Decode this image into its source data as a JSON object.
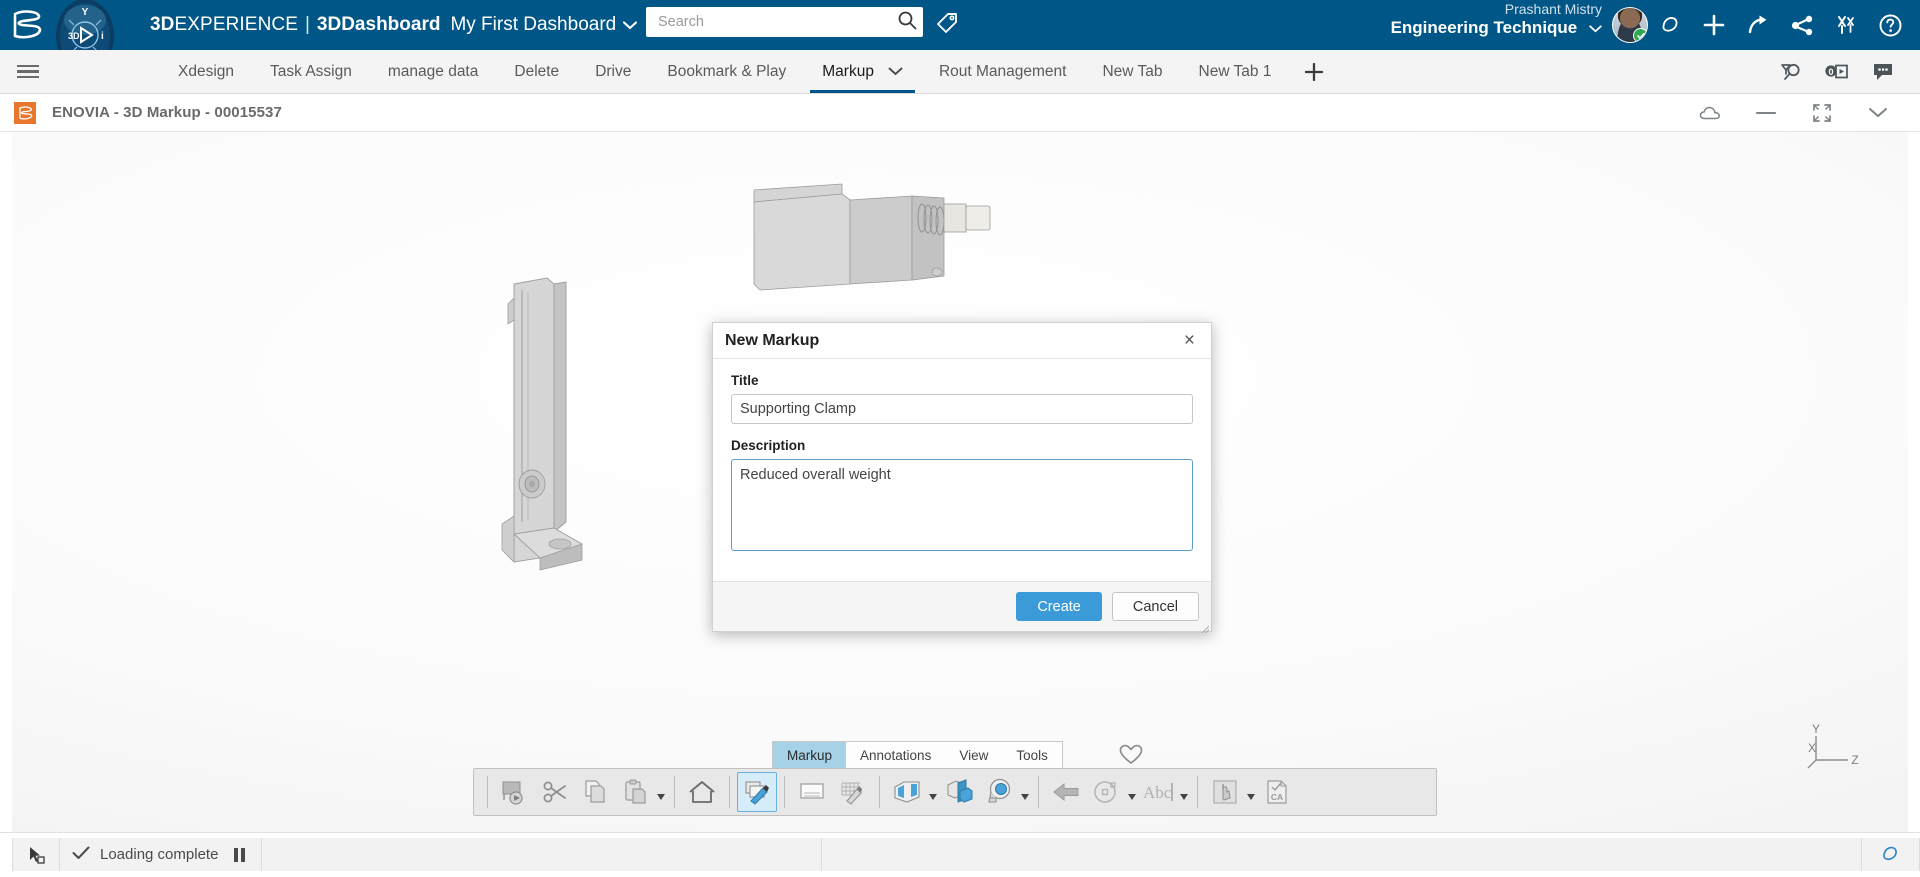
{
  "header": {
    "brand_prefix": "3D",
    "brand_suffix": "EXPERIENCE",
    "separator": "|",
    "product": "3DDashboard",
    "dashboard_name": "My First Dashboard",
    "caret": "⌄",
    "search_placeholder": "Search",
    "search_value": "",
    "user_name": "Prashant Mistry",
    "user_role": "Engineering Technique",
    "icons": [
      "ds-logo-icon",
      "compass-icon",
      "search-icon",
      "tag-icon",
      "avatar",
      "notification-bell-icon",
      "add-plus-icon",
      "share-arrow-icon",
      "social-share-icon",
      "collaboration-icon",
      "help-icon"
    ]
  },
  "tabbar": {
    "menu_icon": "hamburger-menu-icon",
    "tabs": [
      {
        "label": "Xdesign",
        "active": false,
        "has_caret": false
      },
      {
        "label": "Task Assign",
        "active": false,
        "has_caret": false
      },
      {
        "label": "manage data",
        "active": false,
        "has_caret": false
      },
      {
        "label": "Delete",
        "active": false,
        "has_caret": false
      },
      {
        "label": "Drive",
        "active": false,
        "has_caret": false
      },
      {
        "label": "Bookmark & Play",
        "active": false,
        "has_caret": false
      },
      {
        "label": "Markup",
        "active": true,
        "has_caret": true
      },
      {
        "label": "Rout Management",
        "active": false,
        "has_caret": false
      },
      {
        "label": "New Tab",
        "active": false,
        "has_caret": false
      },
      {
        "label": "New Tab 1",
        "active": false,
        "has_caret": false
      }
    ],
    "add_tab_label": "+",
    "right_icons": [
      "search-inspect-icon",
      "media-play-count-icon",
      "comments-icon"
    ]
  },
  "app_window": {
    "logo": "enovia-3ds-icon",
    "title": "ENOVIA - 3D Markup - 00015537",
    "controls": [
      "cloud-icon",
      "minimize-icon",
      "fullscreen-icon",
      "chevron-down-icon"
    ]
  },
  "viewport": {
    "axis_labels": {
      "x": "X",
      "y": "Y",
      "z": "Z"
    },
    "background_note": "3D model of a supporting clamp bracket assembly"
  },
  "command_tabs": {
    "items": [
      {
        "label": "Markup",
        "active": true
      },
      {
        "label": "Annotations",
        "active": false
      },
      {
        "label": "View",
        "active": false
      },
      {
        "label": "Tools",
        "active": false
      }
    ],
    "favorite_icon": "heart-icon"
  },
  "toolbar": {
    "tools": [
      {
        "name": "screen-capture-icon",
        "selected": false,
        "caret": false
      },
      {
        "name": "cut-scissors-icon",
        "selected": false,
        "caret": false
      },
      {
        "name": "copy-icon",
        "selected": false,
        "caret": false
      },
      {
        "name": "paste-icon",
        "selected": false,
        "caret": true
      },
      {
        "name": "home-icon",
        "selected": false,
        "caret": false
      },
      {
        "name": "new-markup-icon",
        "selected": true,
        "caret": false
      },
      {
        "name": "slide-icon",
        "selected": false,
        "caret": false
      },
      {
        "name": "grid-edit-icon",
        "selected": false,
        "caret": false
      },
      {
        "name": "view-capture-icon",
        "selected": false,
        "caret": true
      },
      {
        "name": "section-view-icon",
        "selected": false,
        "caret": false
      },
      {
        "name": "measure-tape-icon",
        "selected": false,
        "caret": true
      },
      {
        "name": "arrow-annotation-icon",
        "selected": false,
        "caret": false
      },
      {
        "name": "circle-annotation-icon",
        "selected": false,
        "caret": true
      },
      {
        "name": "text-abc-icon",
        "selected": false,
        "caret": true
      },
      {
        "name": "pointer-hand-icon",
        "selected": false,
        "caret": true
      },
      {
        "name": "export-ca-icon",
        "selected": false,
        "caret": false
      }
    ]
  },
  "dialog": {
    "title": "New Markup",
    "close_label": "×",
    "title_field": {
      "label": "Title",
      "value": "Supporting Clamp",
      "placeholder": ""
    },
    "description_field": {
      "label": "Description",
      "value": "Reduced overall weight",
      "placeholder": ""
    },
    "create_label": "Create",
    "cancel_label": "Cancel"
  },
  "statusbar": {
    "pick_icon": "pick-cursor-icon",
    "check_icon": "check-icon",
    "status_text": "Loading complete",
    "pause_icon": "pause-icon",
    "bell_icon": "notification-bell-icon"
  },
  "colors": {
    "header_blue": "#005686",
    "accent_blue": "#3b9bd9",
    "tab_active_underline": "#005686",
    "cmdtab_active": "#a6d2e8",
    "enovia_orange": "#e8762c",
    "status_green": "#2ea84f"
  }
}
